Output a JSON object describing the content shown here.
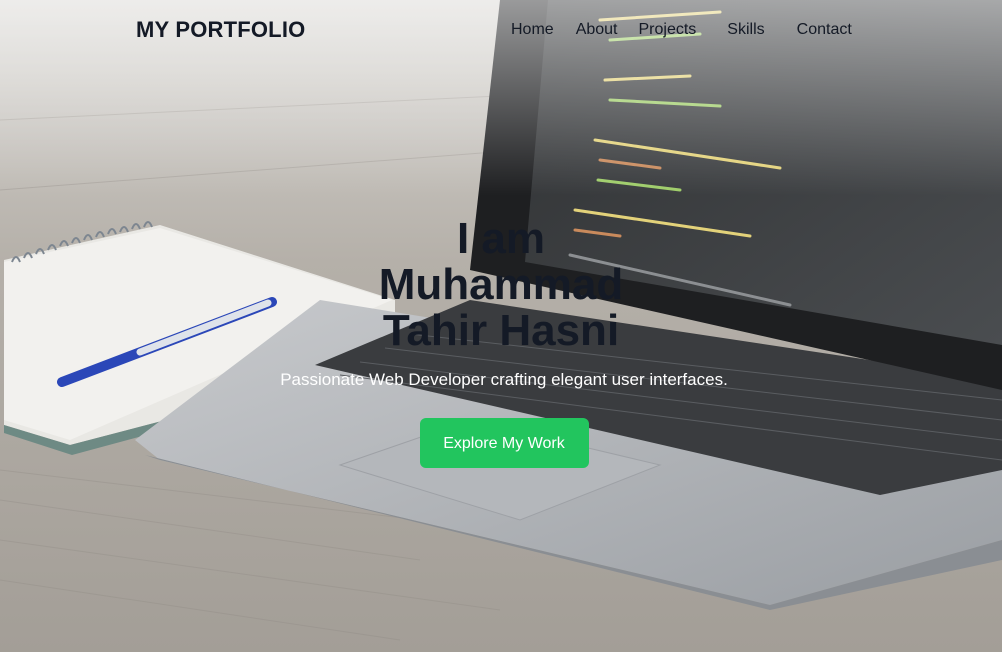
{
  "brand": "MY PORTFOLIO",
  "nav": {
    "items": [
      "Home",
      "About",
      "Projects",
      "Skills",
      "Contact"
    ]
  },
  "hero": {
    "title": "I am Muhammad Tahir Hasni",
    "subtitle": "Passionate Web Developer crafting elegant user interfaces.",
    "button_label": "Explore My Work"
  },
  "colors": {
    "accent": "#22c55e",
    "text_dark": "#141a26"
  }
}
